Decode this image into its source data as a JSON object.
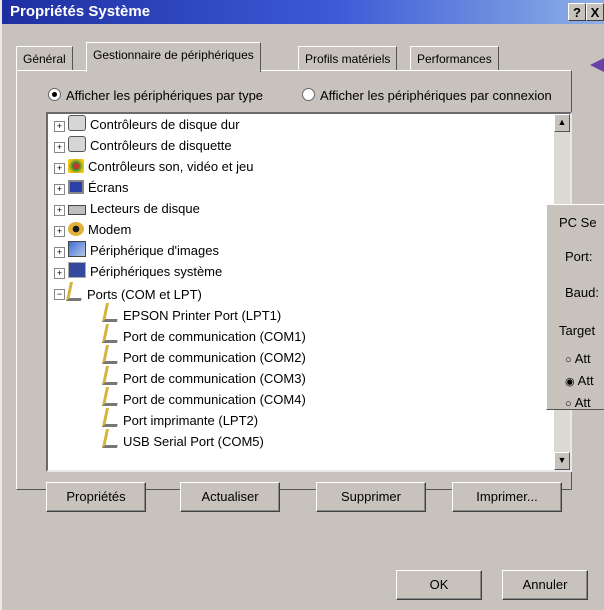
{
  "window": {
    "title": "Propriétés Système",
    "help_btn": "?",
    "close_btn": "X"
  },
  "tabs": [
    "Général",
    "Gestionnaire de périphériques",
    "Profils matériels",
    "Performances"
  ],
  "radios": {
    "by_type": "Afficher les périphériques par type",
    "by_connection": "Afficher les périphériques par connexion",
    "selected": "by_type"
  },
  "tree": {
    "categories": [
      {
        "label": "Contrôleurs de disque dur",
        "icon": "disk-controller-icon",
        "expanded": false
      },
      {
        "label": "Contrôleurs de disquette",
        "icon": "floppy-controller-icon",
        "expanded": false
      },
      {
        "label": "Contrôleurs son, vidéo et jeu",
        "icon": "sound-video-game-icon",
        "expanded": false
      },
      {
        "label": "Écrans",
        "icon": "monitor-icon",
        "expanded": false
      },
      {
        "label": "Lecteurs de disque",
        "icon": "disk-drive-icon",
        "expanded": false
      },
      {
        "label": "Modem",
        "icon": "modem-icon",
        "expanded": false
      },
      {
        "label": "Périphérique d'images",
        "icon": "imaging-device-icon",
        "expanded": false
      },
      {
        "label": "Périphériques système",
        "icon": "system-device-icon",
        "expanded": false
      },
      {
        "label": "Ports (COM et LPT)",
        "icon": "port-icon",
        "expanded": true
      }
    ],
    "ports": [
      "EPSON Printer Port (LPT1)",
      "Port de communication (COM1)",
      "Port de communication (COM2)",
      "Port de communication (COM3)",
      "Port de communication (COM4)",
      "Port imprimante (LPT2)",
      "USB Serial Port (COM5)"
    ]
  },
  "buttons": {
    "properties": "Propriétés",
    "refresh": "Actualiser",
    "remove": "Supprimer",
    "print": "Imprimer...",
    "ok": "OK",
    "cancel": "Annuler"
  },
  "side_panel": {
    "title": "PC Se",
    "port_label": "Port:",
    "baud_label": "Baud:",
    "target_label": "Target",
    "options": [
      "Att",
      "Att",
      "Att"
    ],
    "selected_option": 1
  },
  "colors": {
    "titlebar_start": "#1e2fa0",
    "face": "#c7c3bc",
    "arrow": "#6a3fa8"
  }
}
